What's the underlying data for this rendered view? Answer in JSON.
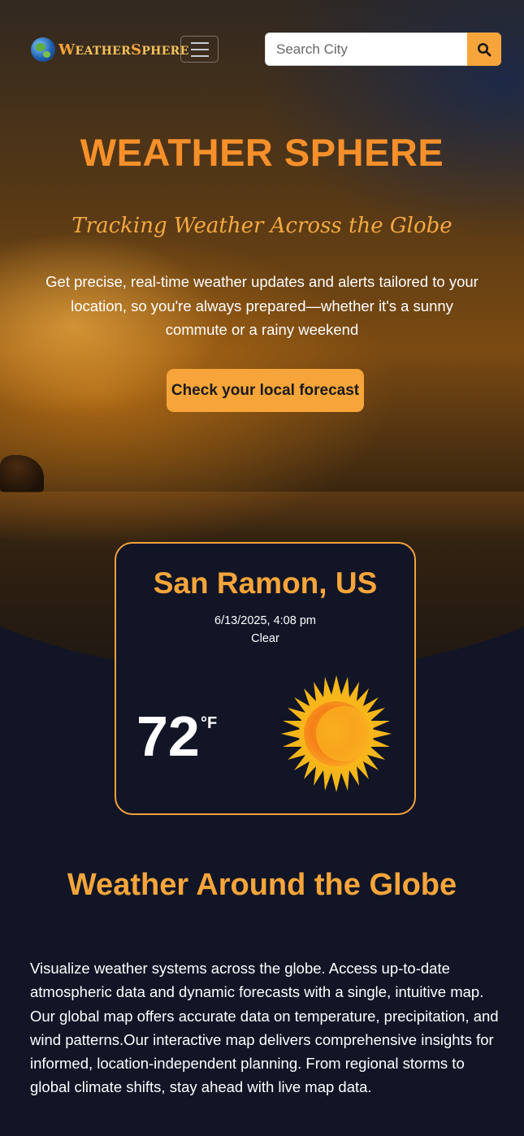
{
  "brand": {
    "first_initial": "W",
    "first_rest": "EATHER",
    "second_initial": "S",
    "second_rest": "PHERE"
  },
  "search": {
    "placeholder": "Search City"
  },
  "hero": {
    "title": "WEATHER SPHERE",
    "tagline": "Tracking Weather Across the Globe",
    "description": "Get precise, real-time weather updates and alerts tailored to your location, so you're always prepared—whether it's a sunny commute or a rainy weekend",
    "cta_label": "Check your local forecast"
  },
  "weather_card": {
    "city": "San Ramon, US",
    "datetime": "6/13/2025, 4:08 pm",
    "condition": "Clear",
    "temperature": "72",
    "unit": "°F",
    "icon": "sun-icon"
  },
  "globe_section": {
    "title": "Weather Around the Globe",
    "description": "Visualize weather systems across the globe. Access up-to-date atmospheric data and dynamic forecasts with a single, intuitive map. Our global map offers accurate data on temperature, precipitation, and wind patterns.Our interactive map delivers comprehensive insights for informed, location-independent planning. From regional storms to global climate shifts, stay ahead with live map data."
  },
  "colors": {
    "accent": "#f7a53a",
    "title_orange": "#f7902a",
    "background": "#111526"
  }
}
